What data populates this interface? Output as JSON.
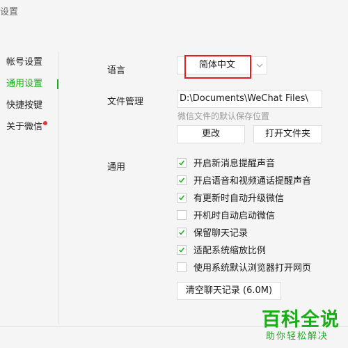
{
  "window": {
    "title": "设置"
  },
  "sidebar": {
    "items": [
      {
        "label": "帐号设置",
        "active": false
      },
      {
        "label": "通用设置",
        "active": true
      },
      {
        "label": "快捷按键",
        "active": false
      },
      {
        "label": "关于微信",
        "active": false,
        "badge": "red-dot"
      }
    ]
  },
  "language": {
    "label": "语言",
    "selected": "简体中文"
  },
  "file_management": {
    "label": "文件管理",
    "path": "D:\\Documents\\WeChat Files\\",
    "hint": "微信文件的默认保存位置",
    "change_label": "更改",
    "open_folder_label": "打开文件夹"
  },
  "general": {
    "label": "通用",
    "options": [
      {
        "label": "开启新消息提醒声音",
        "checked": true
      },
      {
        "label": "开启语音和视频通话提醒声音",
        "checked": true
      },
      {
        "label": "有更新时自动升级微信",
        "checked": true
      },
      {
        "label": "开机时自动启动微信",
        "checked": false
      },
      {
        "label": "保留聊天记录",
        "checked": true
      },
      {
        "label": "适配系统缩放比例",
        "checked": true
      },
      {
        "label": "使用系统默认浏览器打开网页",
        "checked": false
      }
    ],
    "clear_history_label": "清空聊天记录 (6.0M)"
  },
  "watermark": {
    "main": "百科全说",
    "sub": "助你轻松解决"
  },
  "colors": {
    "accent": "#1aad19",
    "highlight": "#e02020",
    "badge": "#e53935"
  }
}
